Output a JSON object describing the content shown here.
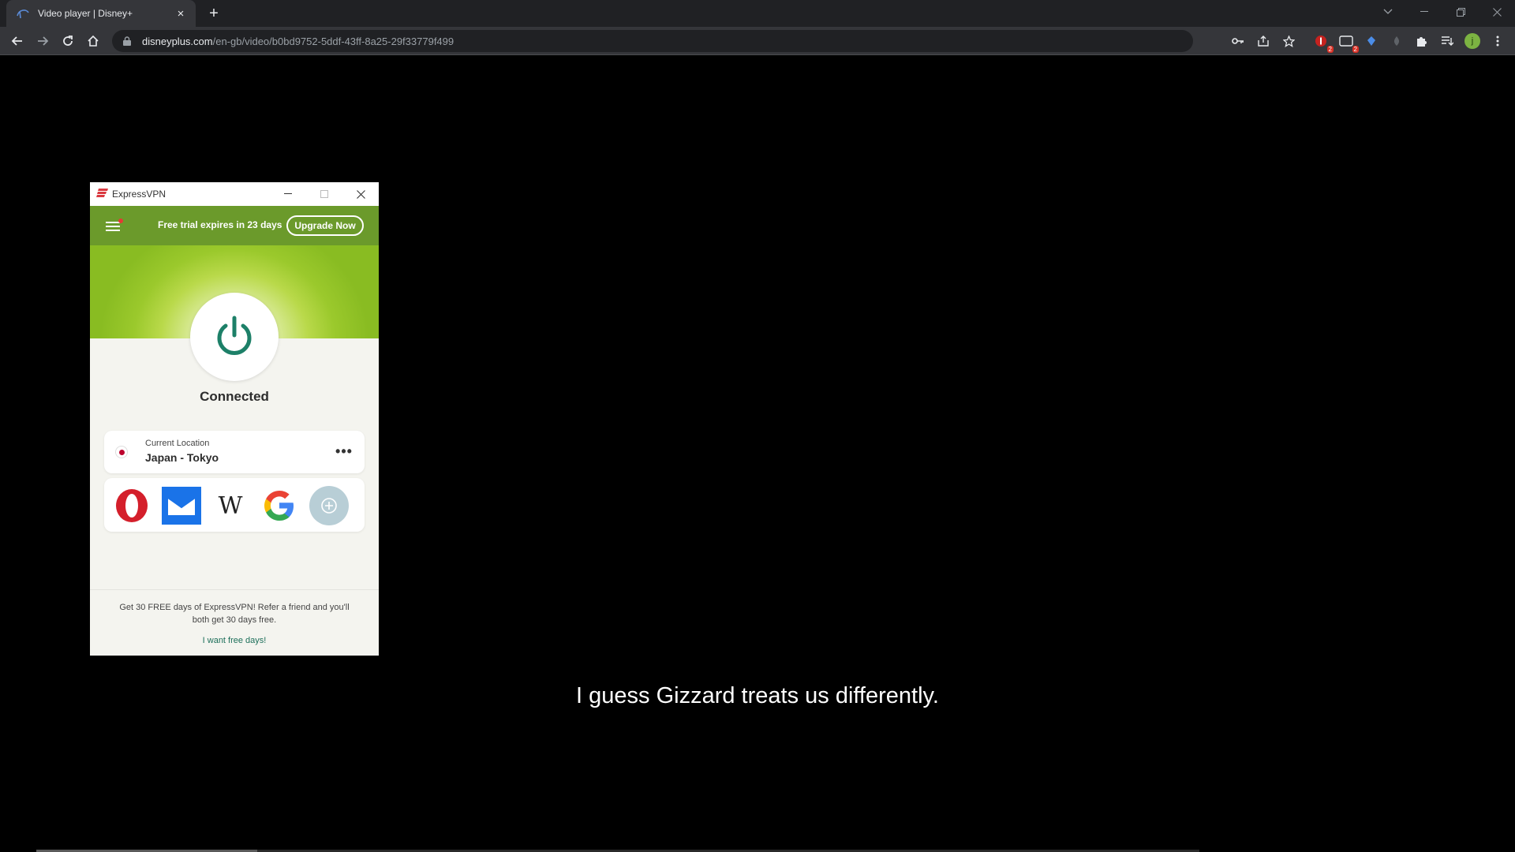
{
  "browser": {
    "tab_title": "Video player | Disney+",
    "close_glyph": "×",
    "new_tab_glyph": "+",
    "url_host": "disneyplus.com",
    "url_path": "/en-gb/video/b0bd9752-5ddf-43ff-8a25-29f33779f499",
    "extension_badges": [
      "2",
      "2"
    ],
    "profile_initial": "j"
  },
  "vpn": {
    "app_name": "ExpressVPN",
    "trial_text": "Free trial expires in 23 days",
    "upgrade_label": "Upgrade Now",
    "status": "Connected",
    "location_label": "Current Location",
    "location_value": "Japan - Tokyo",
    "more_glyph": "•••",
    "shortcuts": [
      "opera-icon",
      "mail-icon",
      "wikipedia-icon",
      "google-icon",
      "add-shortcut-icon"
    ],
    "wiki_glyph": "W",
    "refer_text": "Get 30 FREE days of ExpressVPN! Refer a friend and you'll both get 30 days free.",
    "free_days_link": "I want free days!",
    "colors": {
      "header": "#6b9a2b",
      "accent": "#1d8068",
      "hero": "#9bc92c"
    }
  },
  "video": {
    "subtitle": "I guess Gizzard treats us differently.",
    "progress": 0.19
  }
}
